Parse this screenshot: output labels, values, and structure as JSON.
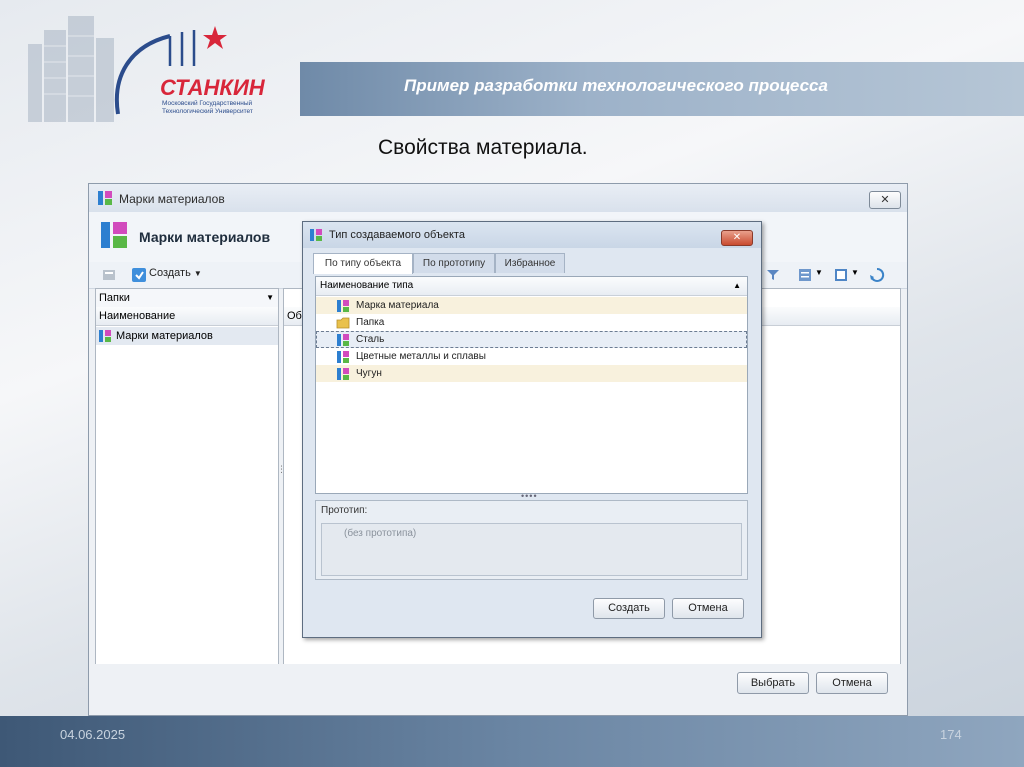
{
  "slide": {
    "title": "Пример разработки технологического процесса",
    "subtitle": "Свойства материала.",
    "date": "04.06.2025",
    "page_number": "174",
    "logo": {
      "name": "СТАНКИН",
      "line1": "Московский Государственный",
      "line2": "Технологический Университет"
    }
  },
  "main_window": {
    "title": "Марки материалов",
    "header": "Марки материалов",
    "close_label": "✕",
    "toolbar": {
      "create_label": "Создать"
    },
    "left_pane": {
      "combo_value": "Папки",
      "column_header": "Наименование",
      "items": [
        "Марки материалов"
      ]
    },
    "right_pane": {
      "column_header_partial": "Обо"
    },
    "buttons": {
      "select": "Выбрать",
      "cancel": "Отмена"
    }
  },
  "dialog": {
    "title": "Тип создаваемого объекта",
    "close_label": "✕",
    "tabs": [
      "По типу объекта",
      "По прототипу",
      "Избранное"
    ],
    "active_tab": 0,
    "list_header": "Наименование типа",
    "items": [
      {
        "label": "Марка материала",
        "icon": "material-icon"
      },
      {
        "label": "Папка",
        "icon": "folder-icon"
      },
      {
        "label": "Сталь",
        "icon": "material-icon"
      },
      {
        "label": "Цветные металлы и сплавы",
        "icon": "material-icon"
      },
      {
        "label": "Чугун",
        "icon": "material-icon"
      }
    ],
    "selected_index": 2,
    "prototype_label": "Прототип:",
    "prototype_value": "(без прототипа)",
    "buttons": {
      "create": "Создать",
      "cancel": "Отмена"
    }
  },
  "colors": {
    "banner": "#8aa2bd",
    "logo_red": "#d8263a",
    "logo_blue": "#2b4c8c",
    "selection": "#e8eef6",
    "row_alt": "#f8f1dd"
  }
}
